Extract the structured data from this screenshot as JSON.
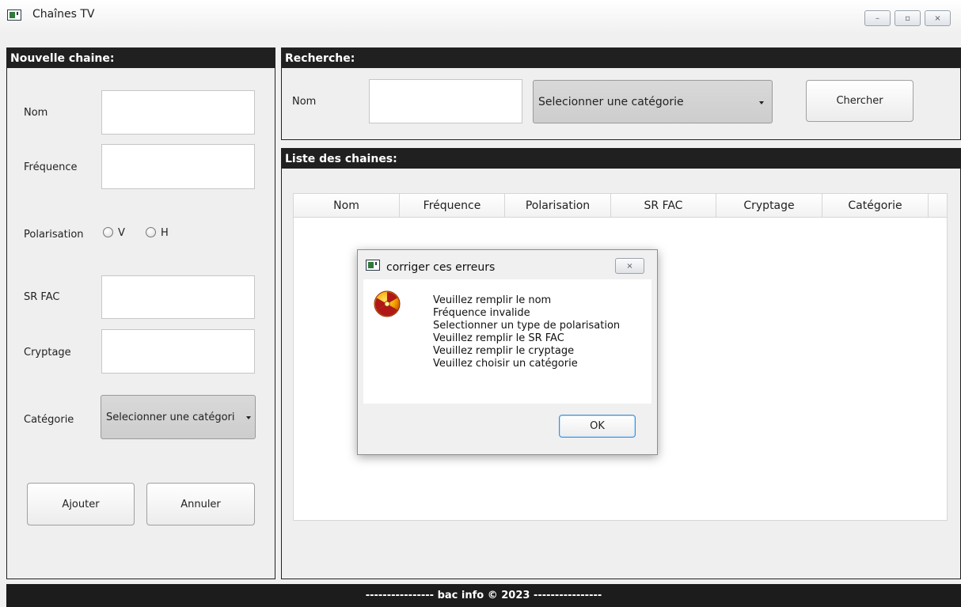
{
  "window": {
    "title": "Chaînes TV",
    "minimize": "–",
    "maximize": "▫",
    "close": "×"
  },
  "left_panel": {
    "header": "Nouvelle chaine:",
    "nom_label": "Nom",
    "nom_value": "",
    "frequence_label": "Fréquence",
    "frequence_value": "",
    "polarisation_label": "Polarisation",
    "radio_v": "V",
    "radio_h": "H",
    "srfac_label": "SR FAC",
    "srfac_value": "",
    "cryptage_label": "Cryptage",
    "cryptage_value": "",
    "categorie_label": "Catégorie",
    "categorie_selected": "Selecionner une catégori",
    "ajouter": "Ajouter",
    "annuler": "Annuler"
  },
  "search_panel": {
    "header": "Recherche:",
    "nom_label": "Nom",
    "nom_value": "",
    "categorie_selected": "Selecionner une catégorie",
    "search_button": "Chercher"
  },
  "list_panel": {
    "header": "Liste des chaines:",
    "columns": [
      "Nom",
      "Fréquence",
      "Polarisation",
      "SR FAC",
      "Cryptage",
      "Catégorie"
    ]
  },
  "dialog": {
    "title": "corriger ces erreurs",
    "close": "×",
    "messages": [
      "Veuillez remplir le nom",
      "Fréquence invalide",
      "Selectionner  un type de polarisation",
      "Veuillez remplir le SR FAC",
      "Veuillez remplir le cryptage",
      "Veuillez choisir un catégorie"
    ],
    "ok": "OK",
    "icon": "error-radiation-icon"
  },
  "footer": {
    "text": "---------------- bac info © 2023 ----------------"
  },
  "colors": {
    "header_bg": "#202020",
    "window_bg": "#f0f0f0",
    "ok_border": "#3c8fd6"
  }
}
